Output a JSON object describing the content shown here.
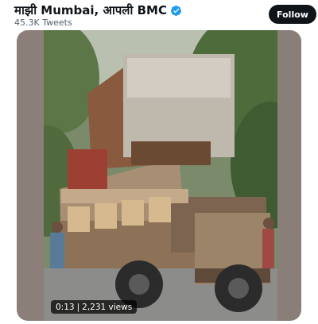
{
  "profile": {
    "name": "माझी Mumbai, आपली BMC",
    "tweet_count": "45.3K Tweets",
    "verified_icon": "verified-badge-icon",
    "badge_color": "#1d9bf0"
  },
  "actions": {
    "follow_label": "Follow"
  },
  "video": {
    "time": "0:13",
    "separator": "|",
    "views": "2,231 views"
  },
  "colors": {
    "follow_bg": "#0f1419",
    "follow_text": "#ffffff",
    "muted_text": "#536471"
  }
}
